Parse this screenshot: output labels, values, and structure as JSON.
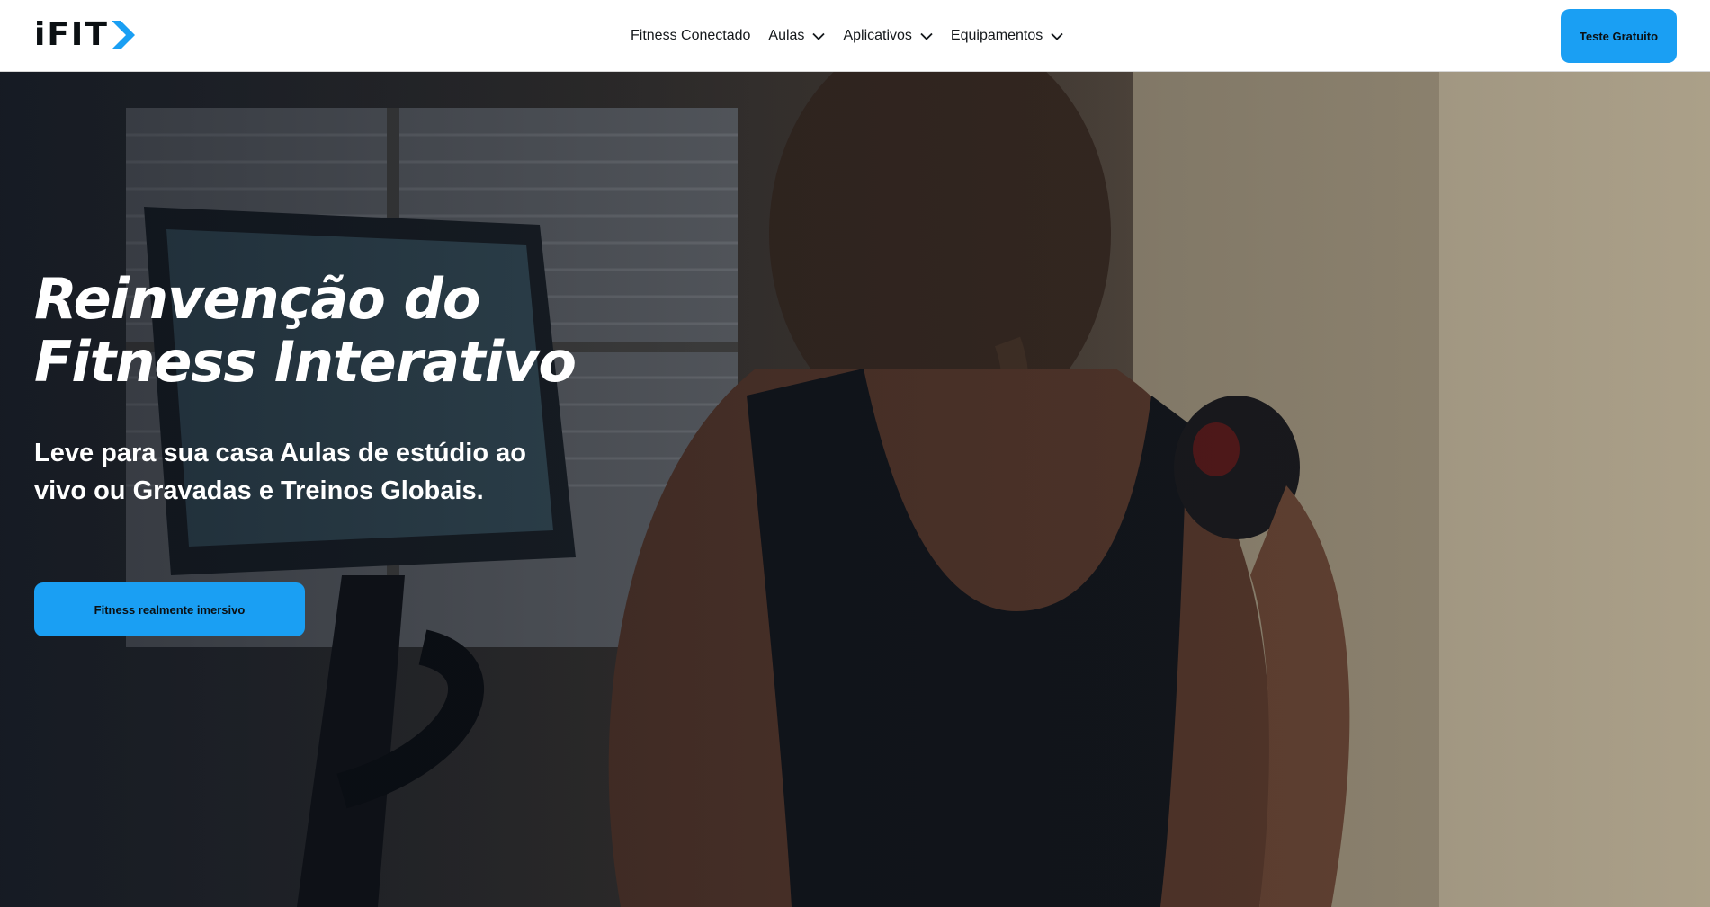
{
  "header": {
    "logo_text": "iFIT",
    "nav": [
      {
        "label": "Fitness Conectado",
        "has_dropdown": false
      },
      {
        "label": "Aulas",
        "has_dropdown": true
      },
      {
        "label": "Aplicativos",
        "has_dropdown": true
      },
      {
        "label": "Equipamentos",
        "has_dropdown": true
      }
    ],
    "cta_label": "Teste Gratuito"
  },
  "hero": {
    "title_line1": "Reinvenção do",
    "title_line2": "Fitness Interativo",
    "subtitle_line1": "Leve para sua casa Aulas de estúdio ao",
    "subtitle_line2": "vivo ou Gravadas e Treinos Globais.",
    "cta_label": "Fitness realmente imersivo"
  },
  "colors": {
    "accent": "#1a9ff3",
    "logo_text": "#0b1013",
    "nav_text": "#14181b",
    "hero_text": "#ffffff"
  },
  "icons": {
    "logo": "ifit-chevron-logo",
    "dropdown": "chevron-down-icon"
  }
}
